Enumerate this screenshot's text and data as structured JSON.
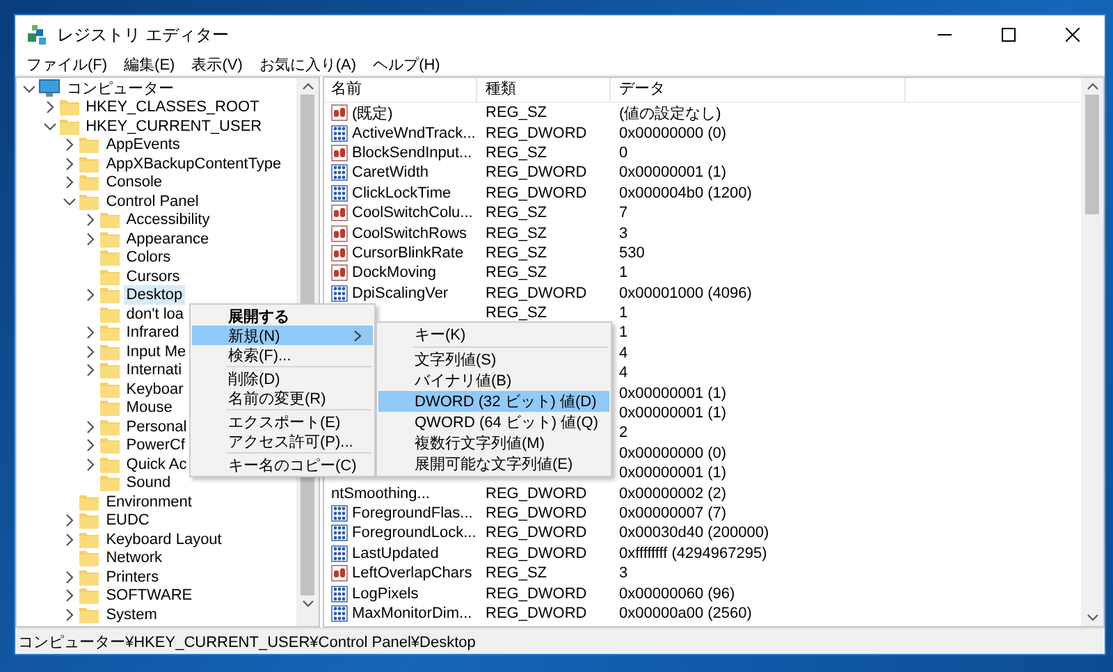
{
  "window": {
    "title": "レジストリ エディター"
  },
  "menu_bar": [
    "ファイル(F)",
    "編集(E)",
    "表示(V)",
    "お気に入り(A)",
    "ヘルプ(H)"
  ],
  "tree": [
    {
      "label": "コンピューター",
      "kind": "computer",
      "expanded": true,
      "selected": false,
      "children": [
        {
          "label": "HKEY_CLASSES_ROOT",
          "kind": "folder",
          "expanded": false,
          "selected": false
        },
        {
          "label": "HKEY_CURRENT_USER",
          "kind": "folder",
          "expanded": true,
          "selected": false,
          "children": [
            {
              "label": "AppEvents",
              "kind": "folder",
              "expanded": false,
              "selected": false
            },
            {
              "label": "AppXBackupContentType",
              "kind": "folder",
              "expanded": false,
              "selected": false
            },
            {
              "label": "Console",
              "kind": "folder",
              "expanded": false,
              "selected": false
            },
            {
              "label": "Control Panel",
              "kind": "folder",
              "expanded": true,
              "selected": false,
              "children": [
                {
                  "label": "Accessibility",
                  "kind": "folder",
                  "expanded": false,
                  "selected": false
                },
                {
                  "label": "Appearance",
                  "kind": "folder",
                  "expanded": false,
                  "selected": false
                },
                {
                  "label": "Colors",
                  "kind": "folder",
                  "selected": false
                },
                {
                  "label": "Cursors",
                  "kind": "folder",
                  "selected": false
                },
                {
                  "label": "Desktop",
                  "kind": "folder",
                  "expanded": false,
                  "selected": true
                },
                {
                  "label": "don't loa",
                  "kind": "folder",
                  "selected": false
                },
                {
                  "label": "Infrared",
                  "kind": "folder",
                  "expanded": false,
                  "selected": false
                },
                {
                  "label": "Input Me",
                  "kind": "folder",
                  "expanded": false,
                  "selected": false
                },
                {
                  "label": "Internati",
                  "kind": "folder",
                  "expanded": false,
                  "selected": false
                },
                {
                  "label": "Keyboar",
                  "kind": "folder",
                  "selected": false
                },
                {
                  "label": "Mouse",
                  "kind": "folder",
                  "selected": false
                },
                {
                  "label": "Personal",
                  "kind": "folder",
                  "expanded": false,
                  "selected": false
                },
                {
                  "label": "PowerCf",
                  "kind": "folder",
                  "expanded": false,
                  "selected": false
                },
                {
                  "label": "Quick Ac",
                  "kind": "folder",
                  "expanded": false,
                  "selected": false
                },
                {
                  "label": "Sound",
                  "kind": "folder",
                  "selected": false
                }
              ]
            },
            {
              "label": "Environment",
              "kind": "folder",
              "selected": false
            },
            {
              "label": "EUDC",
              "kind": "folder",
              "expanded": false,
              "selected": false
            },
            {
              "label": "Keyboard Layout",
              "kind": "folder",
              "expanded": false,
              "selected": false
            },
            {
              "label": "Network",
              "kind": "folder",
              "selected": false
            },
            {
              "label": "Printers",
              "kind": "folder",
              "expanded": false,
              "selected": false
            },
            {
              "label": "SOFTWARE",
              "kind": "folder",
              "expanded": false,
              "selected": false
            },
            {
              "label": "System",
              "kind": "folder",
              "expanded": false,
              "selected": false
            }
          ]
        }
      ]
    }
  ],
  "list": {
    "columns": [
      "名前",
      "種類",
      "データ"
    ],
    "rows": [
      {
        "kind": "sz",
        "name": "(既定)",
        "type": "REG_SZ",
        "data": "(値の設定なし)"
      },
      {
        "kind": "dword",
        "name": "ActiveWndTrack...",
        "type": "REG_DWORD",
        "data": "0x00000000 (0)"
      },
      {
        "kind": "sz",
        "name": "BlockSendInput...",
        "type": "REG_SZ",
        "data": "0"
      },
      {
        "kind": "dword",
        "name": "CaretWidth",
        "type": "REG_DWORD",
        "data": "0x00000001 (1)"
      },
      {
        "kind": "dword",
        "name": "ClickLockTime",
        "type": "REG_DWORD",
        "data": "0x000004b0 (1200)"
      },
      {
        "kind": "sz",
        "name": "CoolSwitchColu...",
        "type": "REG_SZ",
        "data": "7"
      },
      {
        "kind": "sz",
        "name": "CoolSwitchRows",
        "type": "REG_SZ",
        "data": "3"
      },
      {
        "kind": "sz",
        "name": "CursorBlinkRate",
        "type": "REG_SZ",
        "data": "530"
      },
      {
        "kind": "sz",
        "name": "DockMoving",
        "type": "REG_SZ",
        "data": "1"
      },
      {
        "kind": "dword",
        "name": "DpiScalingVer",
        "type": "REG_DWORD",
        "data": "0x00001000 (4096)"
      },
      {
        "type": "REG_SZ",
        "data": "1"
      },
      {
        "data": "1"
      },
      {
        "data": "4"
      },
      {
        "data": "4"
      },
      {
        "data": "0x00000001 (1)"
      },
      {
        "data": "0x00000001 (1)"
      },
      {
        "data": "2"
      },
      {
        "data": "0x00000000 (0)"
      },
      {
        "data": "0x00000001 (1)"
      },
      {
        "name": "ntSmoothing...",
        "type": "REG_DWORD",
        "data": "0x00000002 (2)"
      },
      {
        "kind": "dword",
        "name": "ForegroundFlas...",
        "type": "REG_DWORD",
        "data": "0x00000007 (7)"
      },
      {
        "kind": "dword",
        "name": "ForegroundLock...",
        "type": "REG_DWORD",
        "data": "0x00030d40 (200000)"
      },
      {
        "kind": "dword",
        "name": "LastUpdated",
        "type": "REG_DWORD",
        "data": "0xffffffff (4294967295)"
      },
      {
        "kind": "sz",
        "name": "LeftOverlapChars",
        "type": "REG_SZ",
        "data": "3"
      },
      {
        "kind": "dword",
        "name": "LogPixels",
        "type": "REG_DWORD",
        "data": "0x00000060 (96)"
      },
      {
        "kind": "dword",
        "name": "MaxMonitorDim...",
        "type": "REG_DWORD",
        "data": "0x00000a00 (2560)"
      }
    ]
  },
  "context_menu": {
    "items": [
      {
        "kind": "default",
        "label": "展開する",
        "selected": false
      },
      {
        "kind": "submenu",
        "label": "新規(N)",
        "selected": true
      },
      {
        "kind": "command",
        "label": "検索(F)...",
        "selected": false
      },
      {
        "kind": "separator"
      },
      {
        "kind": "command",
        "label": "削除(D)",
        "selected": false
      },
      {
        "kind": "command",
        "label": "名前の変更(R)",
        "selected": false
      },
      {
        "kind": "separator"
      },
      {
        "kind": "command",
        "label": "エクスポート(E)",
        "selected": false
      },
      {
        "kind": "command",
        "label": "アクセス許可(P)...",
        "selected": false
      },
      {
        "kind": "separator"
      },
      {
        "kind": "command",
        "label": "キー名のコピー(C)",
        "selected": false
      }
    ]
  },
  "submenu": {
    "items": [
      {
        "kind": "command",
        "label": "キー(K)",
        "selected": false
      },
      {
        "kind": "separator"
      },
      {
        "kind": "command",
        "label": "文字列値(S)",
        "selected": false
      },
      {
        "kind": "command",
        "label": "バイナリ値(B)",
        "selected": false
      },
      {
        "kind": "command",
        "label": "DWORD (32 ビット) 値(D)",
        "selected": true
      },
      {
        "kind": "command",
        "label": "QWORD (64 ビット) 値(Q)",
        "selected": false
      },
      {
        "kind": "command",
        "label": "複数行文字列値(M)",
        "selected": false
      },
      {
        "kind": "command",
        "label": "展開可能な文字列値(E)",
        "selected": false
      }
    ]
  },
  "status_bar": "コンピューター¥HKEY_CURRENT_USER¥Control Panel¥Desktop"
}
